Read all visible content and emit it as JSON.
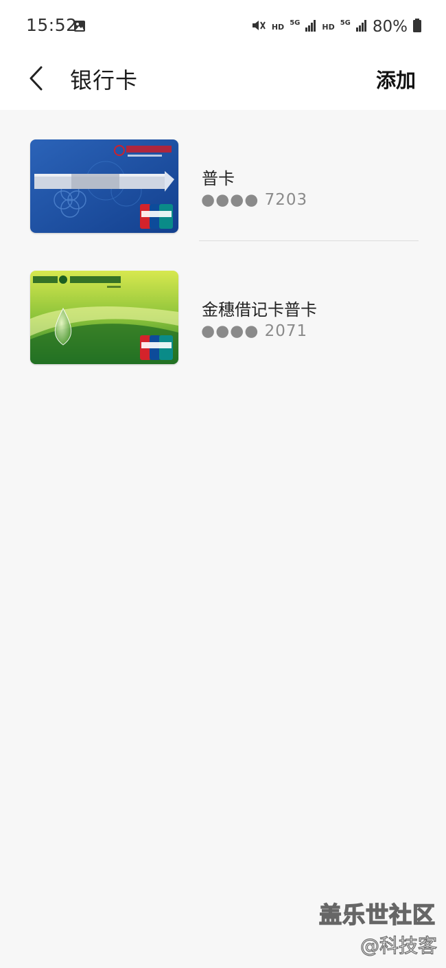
{
  "status_bar": {
    "time": "15:52",
    "hd1": "HD",
    "fiveg1": "5G",
    "hd2": "HD",
    "fiveg2": "5G",
    "battery": "80%",
    "icons": [
      "image-icon",
      "mute-icon",
      "signal-icon",
      "battery-icon"
    ]
  },
  "header": {
    "title": "银行卡",
    "add_label": "添加"
  },
  "cards": [
    {
      "name": "普卡",
      "number": "●●●● 7203",
      "bank_logo_text": "中信银行",
      "network": "UnionPay 银联"
    },
    {
      "name": "金穗借记卡普卡",
      "number": "●●●● 2071",
      "bank_logo_text": "ABC 中国农业银行",
      "network": "UnionPay 银联"
    }
  ],
  "watermark": {
    "main": "盖乐世社区",
    "sub": "@科技客"
  },
  "colors": {
    "background": "#f7f7f7",
    "header_bg": "#ffffff",
    "text_primary": "#222222",
    "text_secondary": "#8a8a8a",
    "citic_blue": "#1c4fa3",
    "abc_green": "#5aa31b"
  }
}
